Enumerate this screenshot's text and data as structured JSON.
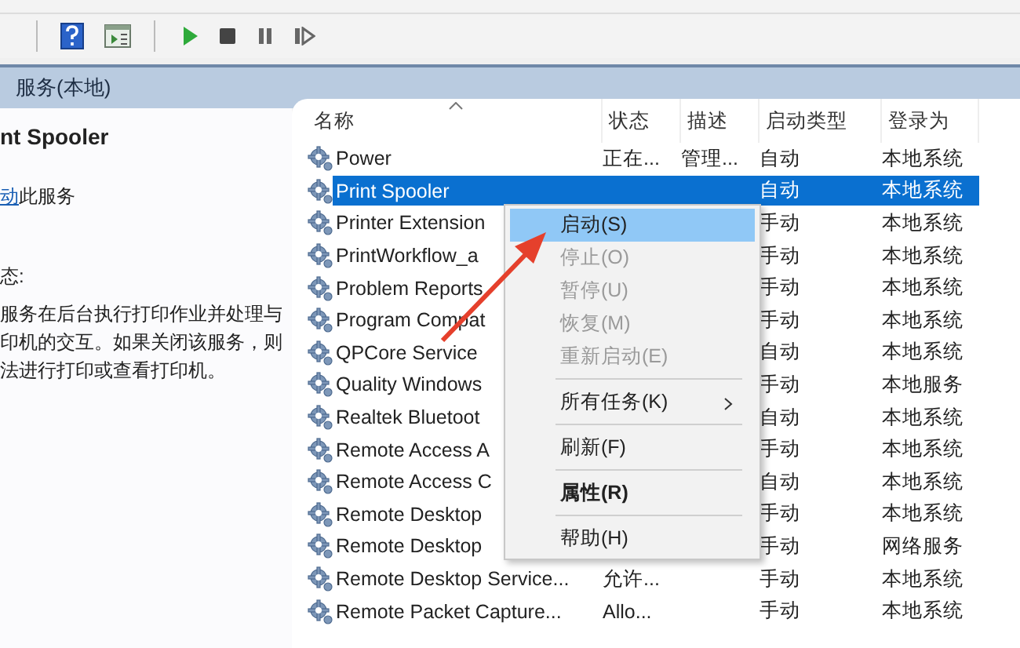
{
  "toolbar": {
    "buttons": [
      {
        "kind": "help"
      },
      {
        "kind": "panel"
      },
      {
        "kind": "start"
      },
      {
        "kind": "stop"
      },
      {
        "kind": "pause"
      },
      {
        "kind": "resume"
      }
    ]
  },
  "header": {
    "title": "服务(本地)"
  },
  "details": {
    "title": "nt Spooler",
    "action_link": "动",
    "action_text": "此服务",
    "description_label": "态:",
    "description_lines": [
      "服务在后台执行打印作业并处理与",
      "印机的交互。如果关闭该服务，则",
      "法进行打印或查看打印机。"
    ]
  },
  "table": {
    "columns": [
      {
        "label": "名称",
        "sorted": true
      },
      {
        "label": "状态",
        "sorted": false
      },
      {
        "label": "描述",
        "sorted": false
      },
      {
        "label": "启动类型",
        "sorted": false
      },
      {
        "label": "登录为",
        "sorted": false
      }
    ],
    "rows": [
      {
        "name": "Power",
        "status": "正在...",
        "description": "管理...",
        "startup": "自动",
        "logon": "本地系统",
        "selected": false
      },
      {
        "name": "Print Spooler",
        "startup": "自动",
        "logon": "本地系统",
        "selected": true
      },
      {
        "name": "Printer Extension",
        "startup": "手动",
        "logon": "本地系统",
        "selected": false
      },
      {
        "name": "PrintWorkflow_a",
        "startup": "手动",
        "logon": "本地系统",
        "selected": false
      },
      {
        "name": "Problem Reports",
        "startup": "手动",
        "logon": "本地系统",
        "selected": false
      },
      {
        "name": "Program Compat",
        "startup": "手动",
        "logon": "本地系统",
        "selected": false
      },
      {
        "name": "QPCore Service",
        "startup": "自动",
        "logon": "本地系统",
        "selected": false
      },
      {
        "name": "Quality Windows",
        "startup": "手动",
        "logon": "本地服务",
        "selected": false
      },
      {
        "name": "Realtek Bluetoot",
        "startup": "自动",
        "logon": "本地系统",
        "selected": false
      },
      {
        "name": "Remote Access A",
        "startup": "手动",
        "logon": "本地系统",
        "selected": false
      },
      {
        "name": "Remote Access C",
        "startup": "自动",
        "logon": "本地系统",
        "selected": false
      },
      {
        "name": "Remote Desktop",
        "startup": "手动",
        "logon": "本地系统",
        "selected": false
      },
      {
        "name": "Remote Desktop",
        "startup": "手动",
        "logon": "网络服务",
        "selected": false
      },
      {
        "name": "Remote Desktop Service...",
        "status": "允许...",
        "startup": "手动",
        "logon": "本地系统",
        "selected": false
      },
      {
        "name": "Remote Packet Capture...",
        "status": "Allo...",
        "startup": "手动",
        "logon": "本地系统",
        "selected": false
      }
    ]
  },
  "context_menu": {
    "items": [
      {
        "label": "启动(S)",
        "selected": true,
        "disabled": false
      },
      {
        "label": "停止(O)",
        "selected": false,
        "disabled": true
      },
      {
        "label": "暂停(U)",
        "selected": false,
        "disabled": true
      },
      {
        "label": "恢复(M)",
        "selected": false,
        "disabled": true
      },
      {
        "label": "重新启动(E)",
        "selected": false,
        "disabled": true,
        "separator_after": true
      },
      {
        "label": "所有任务(K)",
        "selected": false,
        "disabled": false,
        "submenu": true,
        "separator_after": true
      },
      {
        "label": "刷新(F)",
        "selected": false,
        "disabled": false,
        "separator_after": true
      },
      {
        "label": "属性(R)",
        "selected": false,
        "disabled": false,
        "bold": true,
        "separator_after": true
      },
      {
        "label": "帮助(H)",
        "selected": false,
        "disabled": false
      }
    ]
  }
}
